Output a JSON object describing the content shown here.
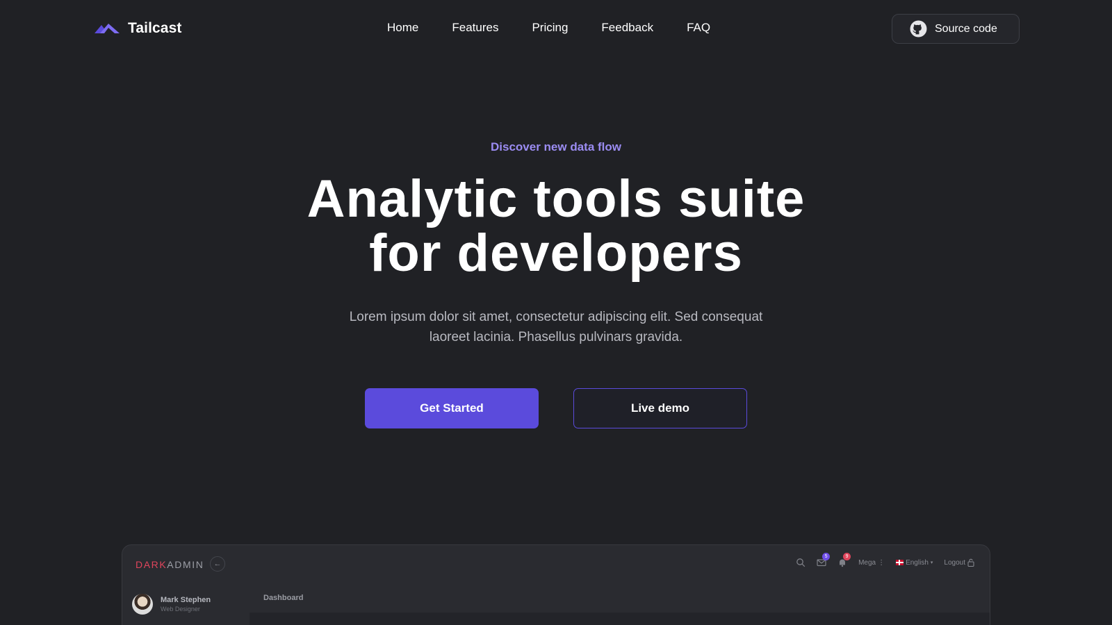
{
  "brand": {
    "name": "Tailcast",
    "logo_icon": "tailcast-logo-icon",
    "accent": "#5b4bdc"
  },
  "nav": {
    "links": [
      {
        "label": "Home"
      },
      {
        "label": "Features"
      },
      {
        "label": "Pricing"
      },
      {
        "label": "Feedback"
      },
      {
        "label": "FAQ"
      }
    ],
    "source_button": {
      "label": "Source code",
      "icon": "github-icon"
    }
  },
  "hero": {
    "eyebrow": "Discover new data flow",
    "title_line1": "Analytic tools suite",
    "title_line2": "for developers",
    "subtitle_line1": "Lorem ipsum dolor sit amet, consectetur adipiscing elit. Sed consequat",
    "subtitle_line2": "laoreet lacinia. Phasellus pulvinars gravida.",
    "primary_cta": "Get Started",
    "secondary_cta": "Live demo"
  },
  "preview": {
    "logo_part1": "DARK",
    "logo_part2": "ADMIN",
    "collapse_icon": "arrow-left-icon",
    "collapse_glyph": "←",
    "mail_badge": "5",
    "notifications_badge": "9",
    "mega_label": "Mega",
    "language_label": "English",
    "logout_label": "Logout",
    "user_name": "Mark Stephen",
    "user_role": "Web Designer",
    "breadcrumb": "Dashboard",
    "colors": {
      "logo_red": "#e0455c",
      "mail_badge": "#6f4ee8",
      "notification_badge": "#e0455c"
    }
  }
}
